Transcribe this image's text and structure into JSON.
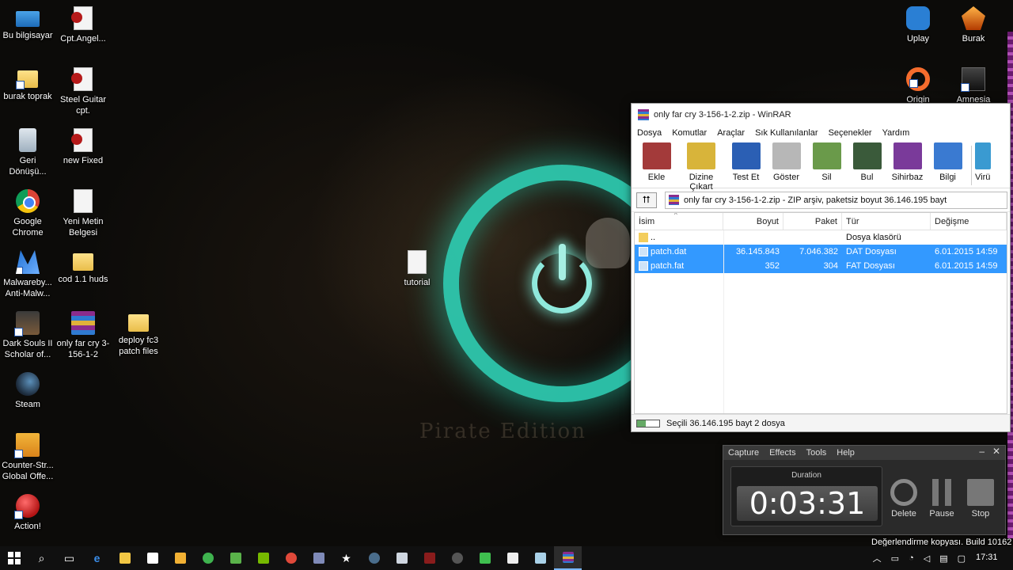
{
  "desktop": {
    "icons": [
      {
        "label": "Bu bilgisayar",
        "icon": "computer-icon"
      },
      {
        "label": "Cpt.Angel...",
        "icon": "document-icon"
      },
      {
        "label": "burak toprak",
        "icon": "user-folder-icon"
      },
      {
        "label": "Steel Guitar cpt.",
        "icon": "document-icon"
      },
      {
        "label": "Geri Dönüşü...",
        "icon": "recycle-bin-icon"
      },
      {
        "label": "new Fixed",
        "icon": "document-icon"
      },
      {
        "label": "Google Chrome",
        "icon": "chrome-icon"
      },
      {
        "label": "Yeni Metin Belgesi",
        "icon": "text-file-icon"
      },
      {
        "label": "Malwareby... Anti-Malw...",
        "icon": "malwarebytes-icon"
      },
      {
        "label": "cod 1.1 huds",
        "icon": "folder-icon"
      },
      {
        "label": "tutorial",
        "icon": "text-file-icon"
      },
      {
        "label": "Dark Souls II Scholar of...",
        "icon": "dark-souls-icon"
      },
      {
        "label": "only far cry 3-156-1-2",
        "icon": "winrar-archive-icon"
      },
      {
        "label": "deploy fc3 patch files",
        "icon": "folder-icon"
      },
      {
        "label": "Steam",
        "icon": "steam-icon"
      },
      {
        "label": "Counter-Str... Global Offe...",
        "icon": "csgo-icon"
      },
      {
        "label": "Action!",
        "icon": "action-recorder-icon"
      },
      {
        "label": "Uplay",
        "icon": "uplay-icon"
      },
      {
        "label": "Burak",
        "icon": "burak-icon"
      },
      {
        "label": "Origin",
        "icon": "origin-icon"
      },
      {
        "label": "Amnesia",
        "icon": "amnesia-icon"
      }
    ]
  },
  "winrar": {
    "title": "only far cry 3-156-1-2.zip - WinRAR",
    "menu": [
      "Dosya",
      "Komutlar",
      "Araçlar",
      "Sık Kullanılanlar",
      "Seçenekler",
      "Yardım"
    ],
    "toolbar": [
      {
        "label": "Ekle",
        "color": "#a33a3a"
      },
      {
        "label": "Dizine Çıkart",
        "color": "#d8b43a"
      },
      {
        "label": "Test Et",
        "color": "#2b5fb4"
      },
      {
        "label": "Göster",
        "color": "#b7b7b7"
      },
      {
        "label": "Sil",
        "color": "#6a9a4a"
      },
      {
        "label": "Bul",
        "color": "#3a5a3a"
      },
      {
        "label": "Sihirbaz",
        "color": "#7a3a9a"
      },
      {
        "label": "Bilgi",
        "color": "#3a7ad1"
      },
      {
        "label": "Virü",
        "color": "#3a9ad1"
      }
    ],
    "path": "only far cry 3-156-1-2.zip - ZIP arşiv, paketsiz boyut 36.146.195 bayt",
    "columns": {
      "name": "İsim",
      "size": "Boyut",
      "packed": "Paket",
      "type": "Tür",
      "modified": "Değişme"
    },
    "rows": [
      {
        "name": "..",
        "size": "",
        "packed": "",
        "type": "Dosya klasörü",
        "modified": ""
      },
      {
        "name": "patch.dat",
        "size": "36.145.843",
        "packed": "7.046.382",
        "type": "DAT Dosyası",
        "modified": "6.01.2015 14:59"
      },
      {
        "name": "patch.fat",
        "size": "352",
        "packed": "304",
        "type": "FAT Dosyası",
        "modified": "6.01.2015 14:59"
      }
    ],
    "status": "Seçili 36.146.195 bayt 2 dosya"
  },
  "recorder": {
    "menu": [
      "Capture",
      "Effects",
      "Tools",
      "Help"
    ],
    "minimize": "–",
    "close": "✕",
    "duration_label": "Duration",
    "duration": "0:03:31",
    "buttons": {
      "delete": "Delete",
      "pause": "Pause",
      "stop": "Stop"
    }
  },
  "taskbar": {
    "watermark": "Değerlendirme kopyası. Build 10162",
    "clock": "17:31",
    "items": [
      {
        "name": "search",
        "glyph": "⌕",
        "color": ""
      },
      {
        "name": "task-view",
        "glyph": "▭",
        "color": ""
      },
      {
        "name": "edge",
        "glyph": "e",
        "color": "#3b8eea"
      },
      {
        "name": "file-explorer",
        "glyph": "",
        "color": "#f2c744"
      },
      {
        "name": "store",
        "glyph": "",
        "color": "#ffffff"
      },
      {
        "name": "media",
        "glyph": "",
        "color": "#f2b134"
      },
      {
        "name": "app-green",
        "glyph": "",
        "color": "#3fb34f"
      },
      {
        "name": "app-notepad",
        "glyph": "",
        "color": "#5ab24a"
      },
      {
        "name": "nvidia",
        "glyph": "",
        "color": "#76b900"
      },
      {
        "name": "chrome",
        "glyph": "",
        "color": "#e0493a"
      },
      {
        "name": "app-doc",
        "glyph": "",
        "color": "#7f8ab8"
      },
      {
        "name": "app-star",
        "glyph": "★",
        "color": ""
      },
      {
        "name": "steam",
        "glyph": "",
        "color": "#4a6d8c"
      },
      {
        "name": "app-window",
        "glyph": "",
        "color": "#cfd6e0"
      },
      {
        "name": "assassins-creed",
        "glyph": "",
        "color": "#8a1c1c"
      },
      {
        "name": "app-gear",
        "glyph": "",
        "color": "#555555"
      },
      {
        "name": "app-drum",
        "glyph": "",
        "color": "#3fbf4f"
      },
      {
        "name": "app-c",
        "glyph": "",
        "color": "#eeeeee"
      },
      {
        "name": "app-notepad2",
        "glyph": "",
        "color": "#a9d1e8"
      },
      {
        "name": "winrar",
        "glyph": "",
        "color": "#8b2c8c"
      }
    ]
  }
}
